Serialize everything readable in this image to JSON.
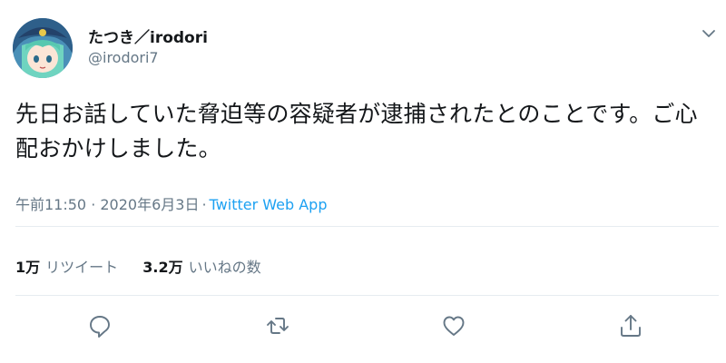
{
  "user": {
    "display_name": "たつき／irodori",
    "handle": "@irodori7"
  },
  "tweet": {
    "text": "先日お話していた脅迫等の容疑者が逮捕されたとのことです。ご心配おかけしました。",
    "timestamp": "午前11:50 · 2020年6月3日",
    "separator": "·",
    "source": "Twitter Web App"
  },
  "stats": {
    "retweets": {
      "count": "1万",
      "label": "リツイート"
    },
    "likes": {
      "count": "3.2万",
      "label": "いいねの数"
    }
  },
  "actions": [
    {
      "icon": "reply-icon"
    },
    {
      "icon": "retweet-icon"
    },
    {
      "icon": "like-icon"
    },
    {
      "icon": "share-icon"
    }
  ],
  "colors": {
    "text": "#14171a",
    "secondary": "#657786",
    "link": "#1da1f2",
    "divider": "#e6ecf0"
  }
}
